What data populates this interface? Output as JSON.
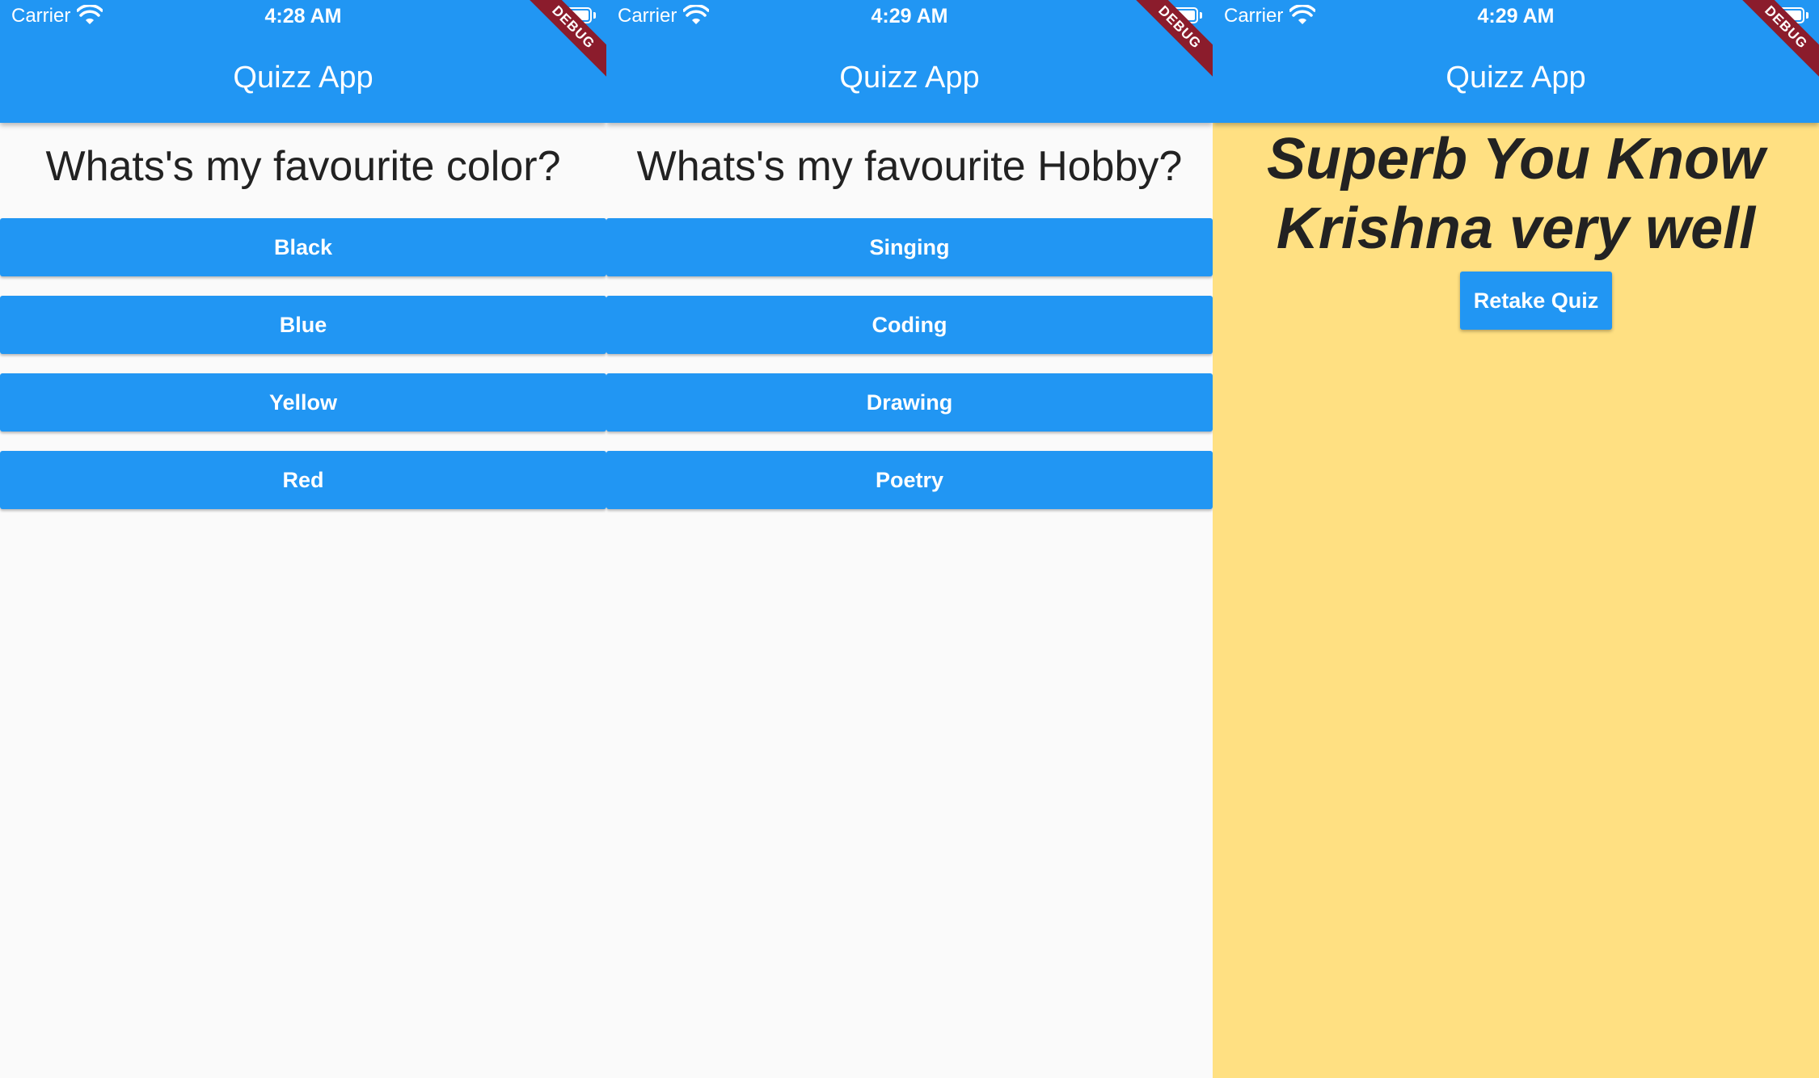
{
  "colors": {
    "appbar": "#2196f3",
    "button": "#2196f3",
    "background": "#fafafa",
    "result_background": "#ffe082",
    "debug_banner": "#8b1c2c"
  },
  "screens": [
    {
      "status": {
        "carrier": "Carrier",
        "time": "4:28 AM"
      },
      "title": "Quizz App",
      "debug": "DEBUG",
      "question": "Whats's my favourite color?",
      "answers": [
        "Black",
        "Blue",
        "Yellow",
        "Red"
      ]
    },
    {
      "status": {
        "carrier": "Carrier",
        "time": "4:29 AM"
      },
      "title": "Quizz App",
      "debug": "DEBUG",
      "question": "Whats's my favourite Hobby?",
      "answers": [
        "Singing",
        "Coding",
        "Drawing",
        "Poetry"
      ]
    },
    {
      "status": {
        "carrier": "Carrier",
        "time": "4:29 AM"
      },
      "title": "Quizz App",
      "debug": "DEBUG",
      "result": "Superb You Know Krishna very well",
      "retake_label": "Retake Quiz"
    }
  ]
}
